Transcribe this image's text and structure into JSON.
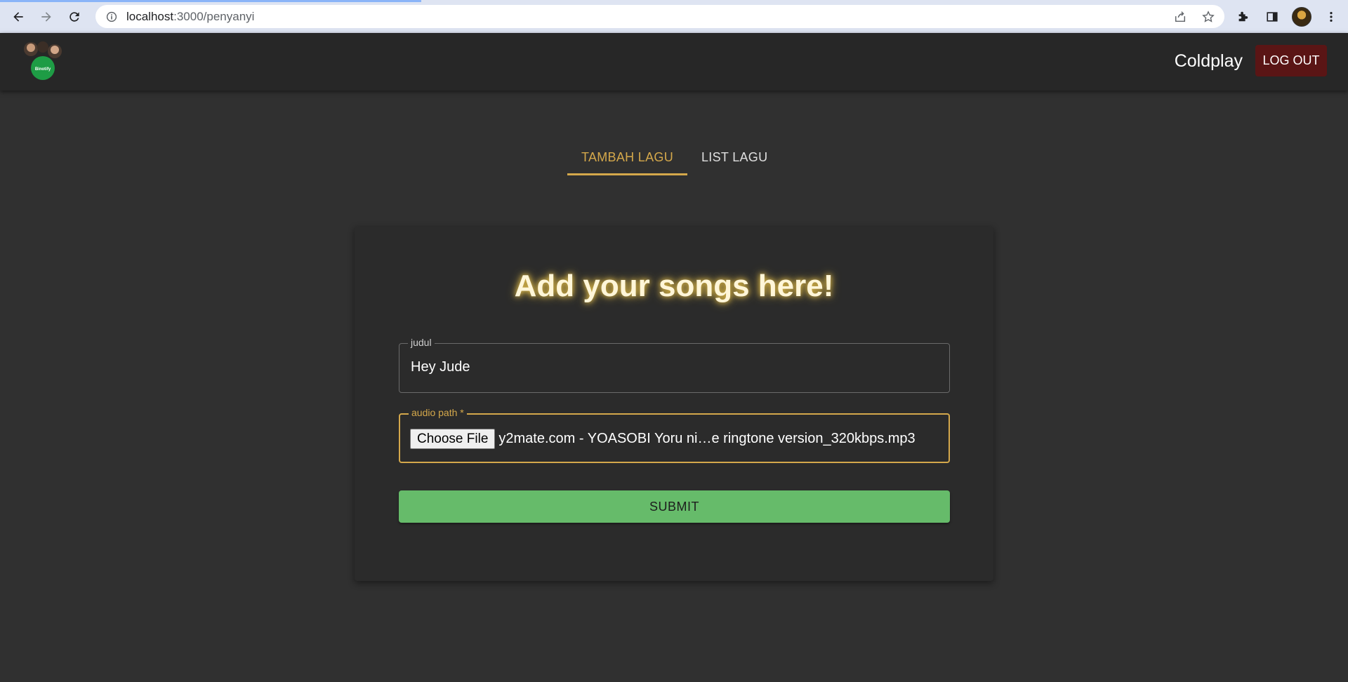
{
  "browser": {
    "url_host": "localhost",
    "url_path": ":3000/penyanyi"
  },
  "header": {
    "logo_text": "Binotify",
    "artist_name": "Coldplay",
    "logout_label": "LOG OUT"
  },
  "tabs": [
    {
      "label": "TAMBAH LAGU",
      "active": true
    },
    {
      "label": "LIST LAGU",
      "active": false
    }
  ],
  "form": {
    "title": "Add your songs here!",
    "judul_label": "judul",
    "judul_value": "Hey Jude",
    "audio_label": "audio path *",
    "choose_file_label": "Choose File",
    "file_name": "y2mate.com - YOASOBI  Yoru ni…e ringtone version_320kbps.mp3",
    "submit_label": "SUBMIT"
  },
  "colors": {
    "accent": "#d4a84b",
    "submit": "#66bb6a",
    "logout": "#5a1515",
    "background": "#303030"
  }
}
